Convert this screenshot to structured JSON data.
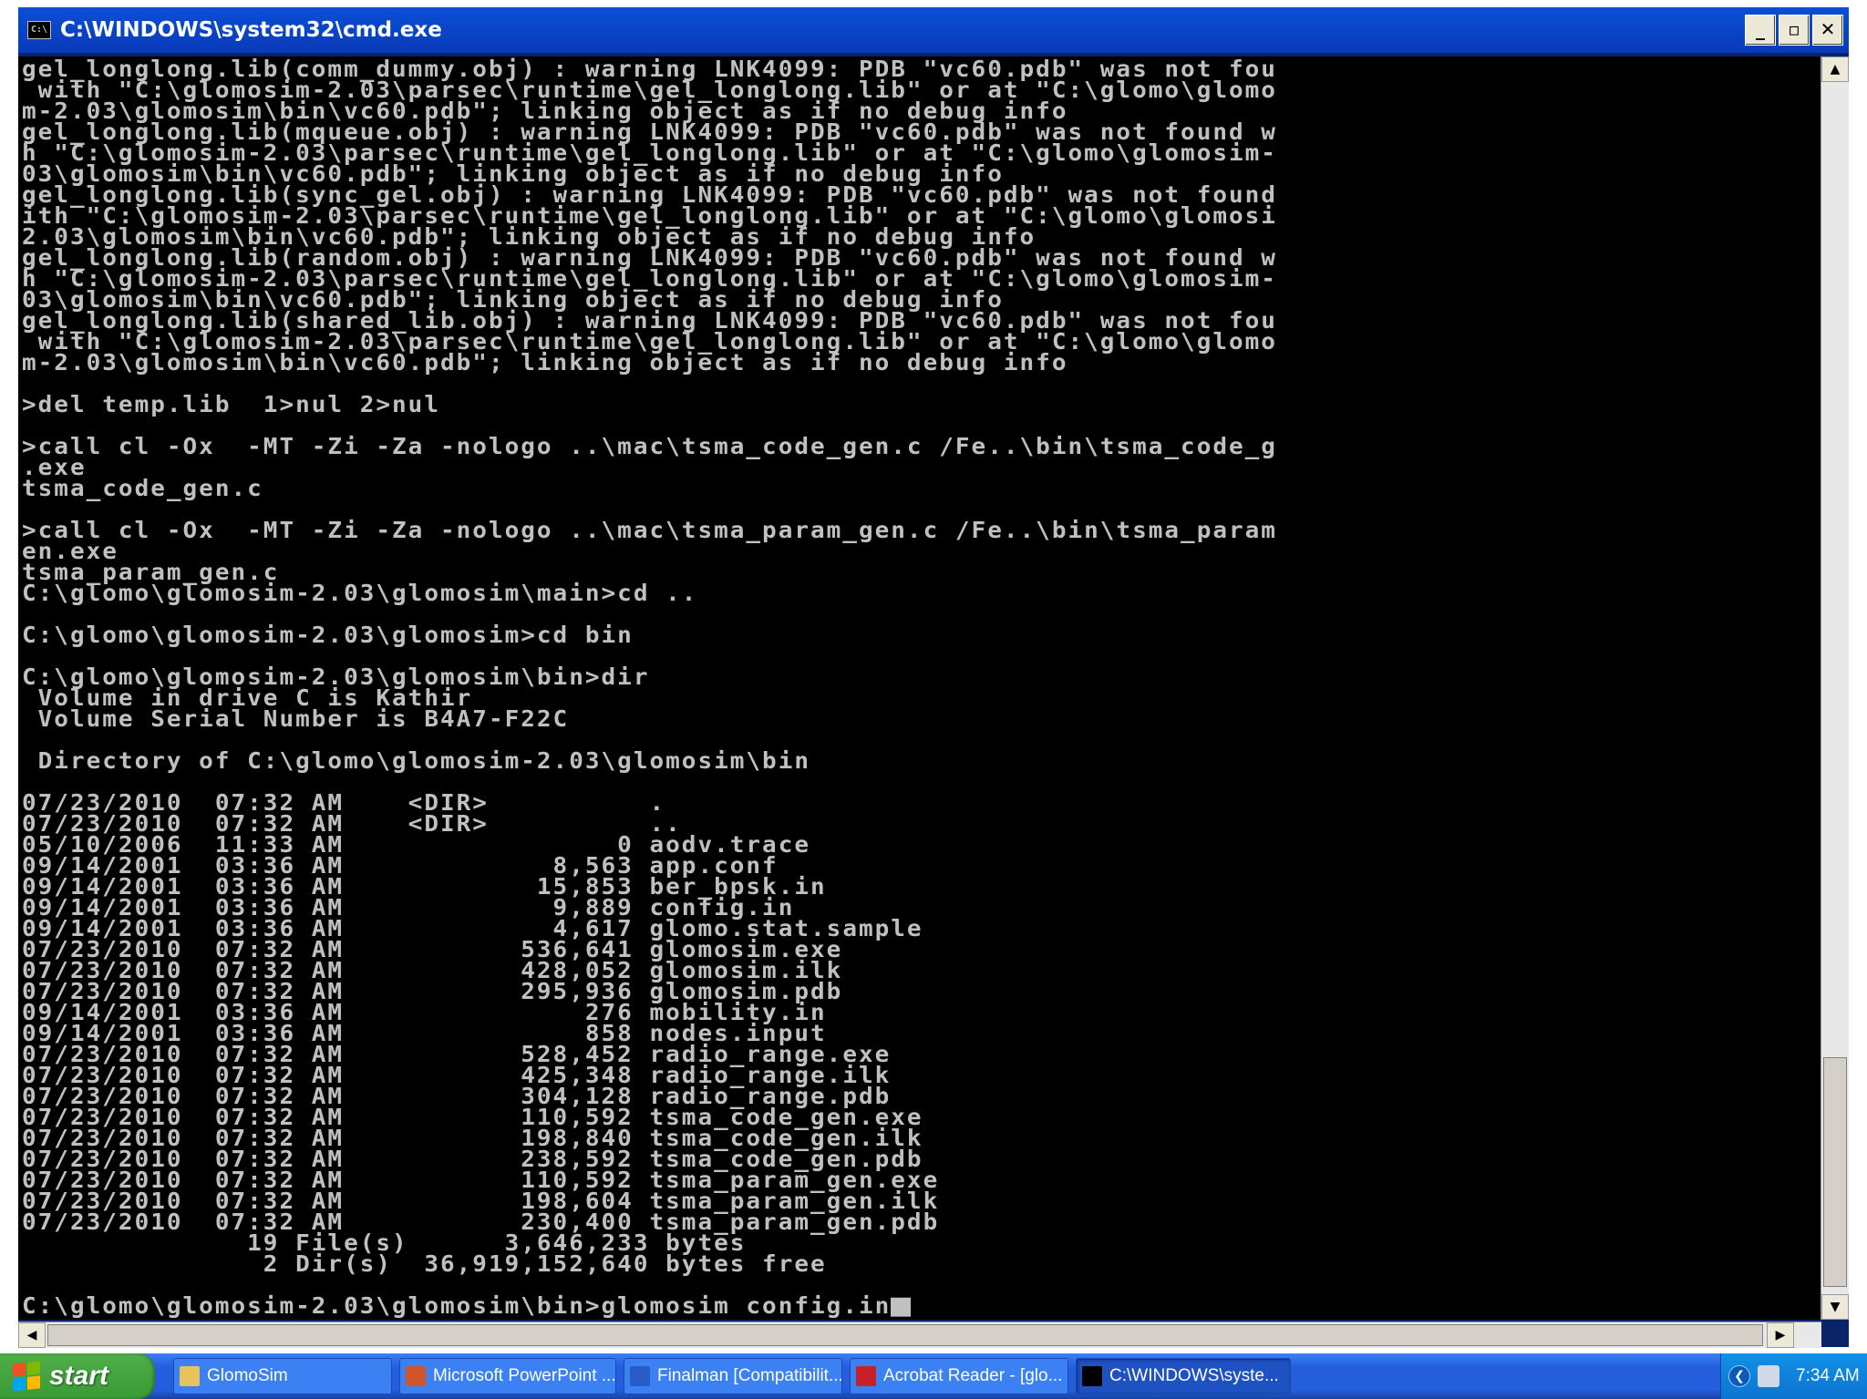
{
  "window": {
    "title": "C:\\WINDOWS\\system32\\cmd.exe",
    "icon_label": "C:\\",
    "buttons": {
      "minimize": "_",
      "maximize": "▫",
      "close": "✕"
    }
  },
  "console": {
    "lines": [
      "gel_longlong.lib(comm_dummy.obj) : warning LNK4099: PDB \"vc60.pdb\" was not fou",
      " with \"C:\\glomosim-2.03\\parsec\\runtime\\gel_longlong.lib\" or at \"C:\\glomo\\glomo",
      "m-2.03\\glomosim\\bin\\vc60.pdb\"; linking object as if no debug info",
      "gel_longlong.lib(mqueue.obj) : warning LNK4099: PDB \"vc60.pdb\" was not found w",
      "h \"C:\\glomosim-2.03\\parsec\\runtime\\gel_longlong.lib\" or at \"C:\\glomo\\glomosim-",
      "03\\glomosim\\bin\\vc60.pdb\"; linking object as if no debug info",
      "gel_longlong.lib(sync_gel.obj) : warning LNK4099: PDB \"vc60.pdb\" was not found",
      "ith \"C:\\glomosim-2.03\\parsec\\runtime\\gel_longlong.lib\" or at \"C:\\glomo\\glomosi",
      "2.03\\glomosim\\bin\\vc60.pdb\"; linking object as if no debug info",
      "gel_longlong.lib(random.obj) : warning LNK4099: PDB \"vc60.pdb\" was not found w",
      "h \"C:\\glomosim-2.03\\parsec\\runtime\\gel_longlong.lib\" or at \"C:\\glomo\\glomosim-",
      "03\\glomosim\\bin\\vc60.pdb\"; linking object as if no debug info",
      "gel_longlong.lib(shared_lib.obj) : warning LNK4099: PDB \"vc60.pdb\" was not fou",
      " with \"C:\\glomosim-2.03\\parsec\\runtime\\gel_longlong.lib\" or at \"C:\\glomo\\glomo",
      "m-2.03\\glomosim\\bin\\vc60.pdb\"; linking object as if no debug info",
      "",
      ">del temp.lib  1>nul 2>nul",
      "",
      ">call cl -Ox  -MT -Zi -Za -nologo ..\\mac\\tsma_code_gen.c /Fe..\\bin\\tsma_code_g",
      ".exe",
      "tsma_code_gen.c",
      "",
      ">call cl -Ox  -MT -Zi -Za -nologo ..\\mac\\tsma_param_gen.c /Fe..\\bin\\tsma_param",
      "en.exe",
      "tsma_param_gen.c",
      "C:\\glomo\\glomosim-2.03\\glomosim\\main>cd ..",
      "",
      "C:\\glomo\\glomosim-2.03\\glomosim>cd bin",
      "",
      "C:\\glomo\\glomosim-2.03\\glomosim\\bin>dir",
      " Volume in drive C is Kathir",
      " Volume Serial Number is B4A7-F22C",
      "",
      " Directory of C:\\glomo\\glomosim-2.03\\glomosim\\bin",
      "",
      "07/23/2010  07:32 AM    <DIR>          .",
      "07/23/2010  07:32 AM    <DIR>          ..",
      "05/10/2006  11:33 AM                 0 aodv.trace",
      "09/14/2001  03:36 AM             8,563 app.conf",
      "09/14/2001  03:36 AM            15,853 ber_bpsk.in",
      "09/14/2001  03:36 AM             9,889 config.in",
      "09/14/2001  03:36 AM             4,617 glomo.stat.sample",
      "07/23/2010  07:32 AM           536,641 glomosim.exe",
      "07/23/2010  07:32 AM           428,052 glomosim.ilk",
      "07/23/2010  07:32 AM           295,936 glomosim.pdb",
      "09/14/2001  03:36 AM               276 mobility.in",
      "09/14/2001  03:36 AM               858 nodes.input",
      "07/23/2010  07:32 AM           528,452 radio_range.exe",
      "07/23/2010  07:32 AM           425,348 radio_range.ilk",
      "07/23/2010  07:32 AM           304,128 radio_range.pdb",
      "07/23/2010  07:32 AM           110,592 tsma_code_gen.exe",
      "07/23/2010  07:32 AM           198,840 tsma_code_gen.ilk",
      "07/23/2010  07:32 AM           238,592 tsma_code_gen.pdb",
      "07/23/2010  07:32 AM           110,592 tsma_param_gen.exe",
      "07/23/2010  07:32 AM           198,604 tsma_param_gen.ilk",
      "07/23/2010  07:32 AM           230,400 tsma_param_gen.pdb",
      "              19 File(s)      3,646,233 bytes",
      "               2 Dir(s)  36,919,152,640 bytes free",
      "",
      "C:\\glomo\\glomosim-2.03\\glomosim\\bin>glomosim config.in"
    ]
  },
  "scrollbars": {
    "up": "▲",
    "down": "▼",
    "left": "◀",
    "right": "▶"
  },
  "taskbar": {
    "start_label": "start",
    "tasks": [
      {
        "label": "GlomoSim",
        "icon": "folder-icon",
        "icon_color": "#e8c25a",
        "active": false
      },
      {
        "label": "Microsoft PowerPoint ...",
        "icon": "powerpoint-icon",
        "icon_color": "#d2542a",
        "active": false
      },
      {
        "label": "Finalman [Compatibilit...",
        "icon": "word-document-icon",
        "icon_color": "#2a5cc8",
        "active": false
      },
      {
        "label": "Acrobat Reader - [glo...",
        "icon": "acrobat-icon",
        "icon_color": "#c8202a",
        "active": false
      },
      {
        "label": "C:\\WINDOWS\\syste...",
        "icon": "cmd-icon",
        "icon_color": "#000000",
        "active": true
      }
    ],
    "tray": {
      "time": "7:34 AM",
      "expand_glyph": "❮"
    }
  },
  "colors": {
    "console_bg": "#000000",
    "console_text": "#c0c0c0",
    "titlebar": "#0a4fd6",
    "taskbar": "#245edc",
    "start": "#3a9a35"
  }
}
